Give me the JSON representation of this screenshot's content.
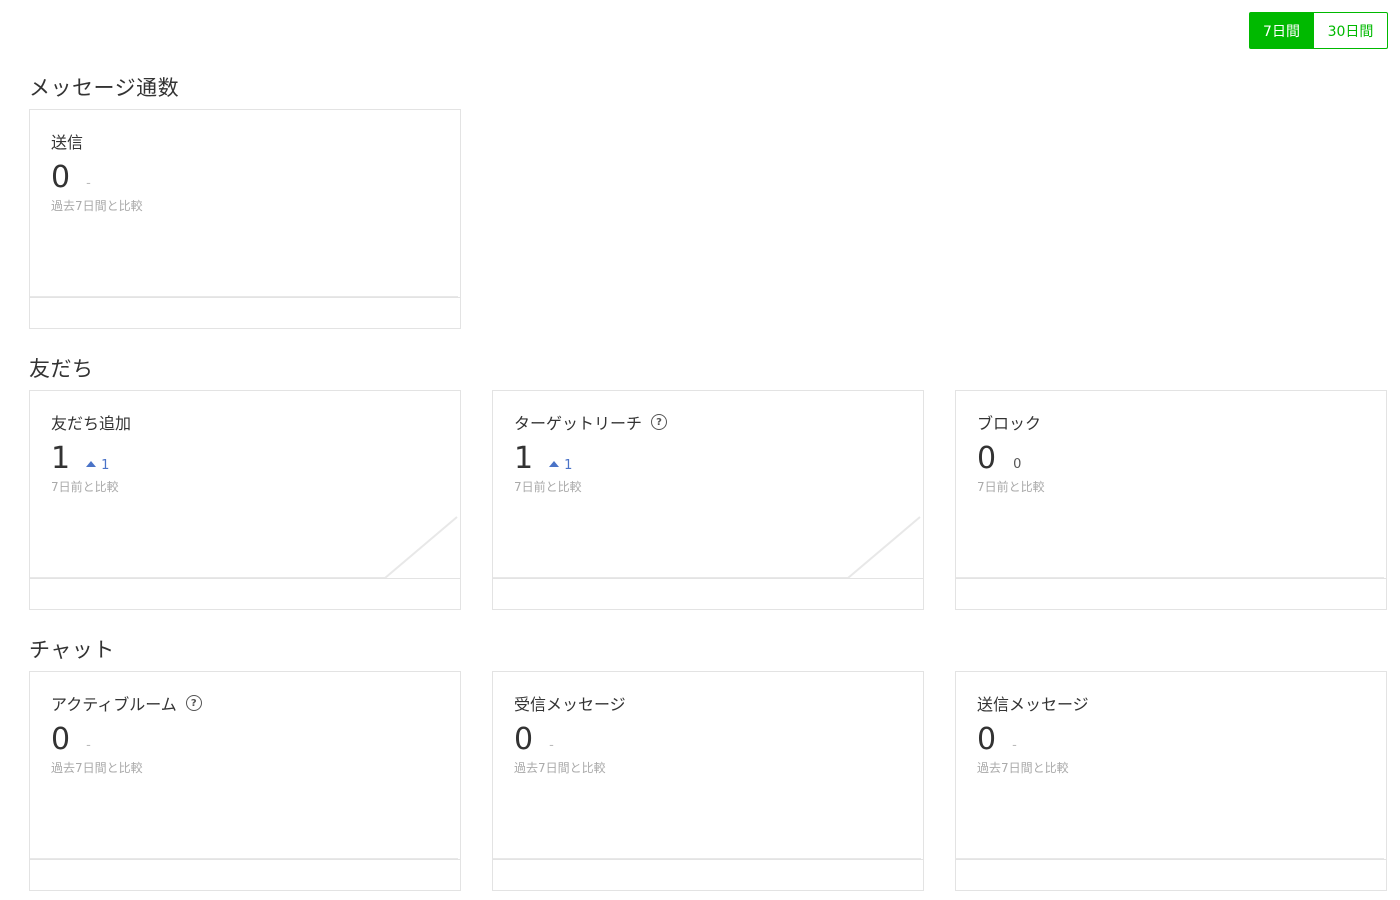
{
  "period_toggle": {
    "options": [
      "7日間",
      "30日間"
    ],
    "selected": "7日間"
  },
  "sections": {
    "messages": {
      "title": "メッセージ通数"
    },
    "friends": {
      "title": "友だち"
    },
    "chat": {
      "title": "チャット"
    }
  },
  "cards": {
    "send": {
      "title": "送信",
      "value": "0",
      "change": "-",
      "compare": "過去7日間と比較",
      "trend": "flat"
    },
    "friends_add": {
      "title": "友だち追加",
      "value": "1",
      "change": "1",
      "compare": "7日前と比較",
      "trend": "up"
    },
    "target_reach": {
      "title": "ターゲットリーチ",
      "value": "1",
      "change": "1",
      "compare": "7日前と比較",
      "trend": "up",
      "help": "?"
    },
    "block": {
      "title": "ブロック",
      "value": "0",
      "change": "0",
      "compare": "7日前と比較",
      "trend": "flat"
    },
    "active_rooms": {
      "title": "アクティブルーム",
      "value": "0",
      "change": "-",
      "compare": "過去7日間と比較",
      "trend": "flat",
      "help": "?"
    },
    "received_messages": {
      "title": "受信メッセージ",
      "value": "0",
      "change": "-",
      "compare": "過去7日間と比較",
      "trend": "flat"
    },
    "sent_messages": {
      "title": "送信メッセージ",
      "value": "0",
      "change": "-",
      "compare": "過去7日間と比較",
      "trend": "flat"
    }
  },
  "colors": {
    "accent": "#00b900",
    "up": "#4a73c7",
    "muted": "#aaaaaa",
    "border": "#e3e3e3"
  },
  "icons": {
    "help": "help-circle-icon",
    "trend_up": "triangle-up-icon"
  }
}
